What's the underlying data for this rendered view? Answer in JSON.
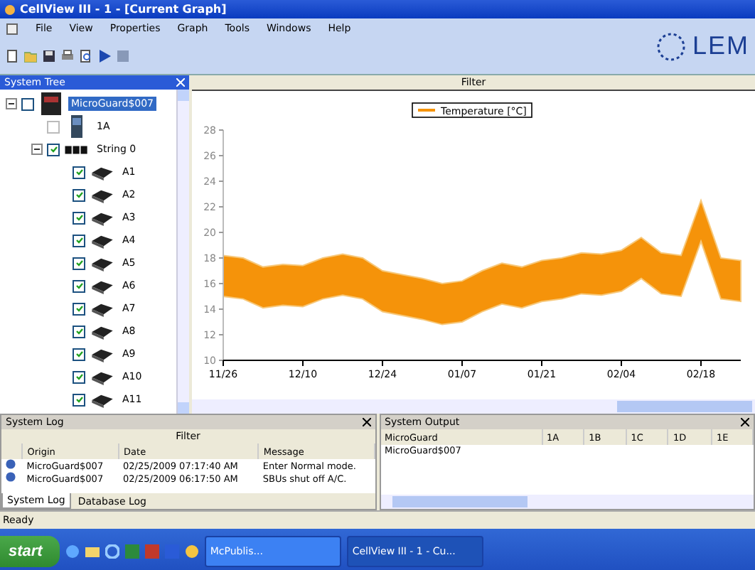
{
  "window": {
    "title": "CellView III - 1 - [Current Graph]"
  },
  "menu": [
    "File",
    "View",
    "Properties",
    "Graph",
    "Tools",
    "Windows",
    "Help"
  ],
  "logo": {
    "text": "LEM"
  },
  "tree_panel": {
    "title": "System Tree",
    "items": [
      {
        "label": "MicroGuard$007",
        "kind": "device",
        "checked": false,
        "selected": true,
        "expanded": true,
        "children": [
          {
            "label": "1A",
            "kind": "sensor",
            "checked": false,
            "disabled": true,
            "selected": false
          },
          {
            "label": "String 0",
            "kind": "string",
            "checked": true,
            "disabled": false,
            "selected": false,
            "expanded": true,
            "children": [
              {
                "label": "A1",
                "kind": "battery",
                "checked": true,
                "selected": false
              },
              {
                "label": "A2",
                "kind": "battery",
                "checked": true,
                "selected": false
              },
              {
                "label": "A3",
                "kind": "battery",
                "checked": true,
                "selected": false
              },
              {
                "label": "A4",
                "kind": "battery",
                "checked": true,
                "selected": false
              },
              {
                "label": "A5",
                "kind": "battery",
                "checked": true,
                "selected": false
              },
              {
                "label": "A6",
                "kind": "battery",
                "checked": true,
                "selected": false
              },
              {
                "label": "A7",
                "kind": "battery",
                "checked": true,
                "selected": false
              },
              {
                "label": "A8",
                "kind": "battery",
                "checked": true,
                "selected": false
              },
              {
                "label": "A9",
                "kind": "battery",
                "checked": true,
                "selected": false
              },
              {
                "label": "A10",
                "kind": "battery",
                "checked": true,
                "selected": false
              },
              {
                "label": "A11",
                "kind": "battery",
                "checked": true,
                "selected": false
              }
            ]
          }
        ]
      }
    ]
  },
  "graph": {
    "filter": "Filter",
    "chart_data": {
      "type": "area",
      "categories": [
        "11/26",
        null,
        null,
        null,
        "12/10",
        null,
        null,
        null,
        "12/24",
        null,
        null,
        null,
        "01/07",
        null,
        null,
        null,
        "01/21",
        null,
        null,
        null,
        "02/04",
        null,
        null,
        null,
        "02/18",
        null,
        null
      ],
      "series": [
        {
          "name": "Temperature [°C]",
          "color": "#f5930a",
          "values": [
            18.2,
            18.0,
            17.3,
            17.5,
            17.4,
            18.0,
            18.3,
            18.0,
            17.0,
            16.7,
            16.4,
            16.0,
            16.2,
            17.0,
            17.6,
            17.3,
            17.8,
            18.0,
            18.4,
            18.3,
            18.6,
            19.6,
            18.4,
            18.2,
            22.5,
            18.0,
            17.8
          ]
        }
      ],
      "ylim": [
        10,
        28
      ],
      "yticks": [
        10,
        12,
        14,
        16,
        18,
        20,
        22,
        24,
        26,
        28
      ]
    }
  },
  "system_log": {
    "title": "System Log",
    "filter": "Filter",
    "columns": [
      "Origin",
      "Date",
      "Message"
    ],
    "rows": [
      [
        "MicroGuard$007",
        "02/25/2009 07:17:40 AM",
        "Enter Normal mode."
      ],
      [
        "MicroGuard$007",
        "02/25/2009 06:17:50 AM",
        "SBUs shut off A/C."
      ]
    ],
    "tabs": [
      {
        "label": "System Log",
        "selected": true
      },
      {
        "label": "Database Log",
        "selected": false
      }
    ]
  },
  "system_output": {
    "title": "System Output",
    "columns": [
      "MicroGuard",
      "1A",
      "1B",
      "1C",
      "1D",
      "1E"
    ],
    "rows": [
      [
        "MicroGuard$007",
        "",
        "",
        "",
        "",
        ""
      ]
    ]
  },
  "status_bar": "Ready",
  "taskbar": {
    "start": "start",
    "tasks": [
      {
        "label": "McPublis...",
        "selected": false
      },
      {
        "label": "CellView III - 1 - Cu...",
        "selected": true
      }
    ]
  }
}
